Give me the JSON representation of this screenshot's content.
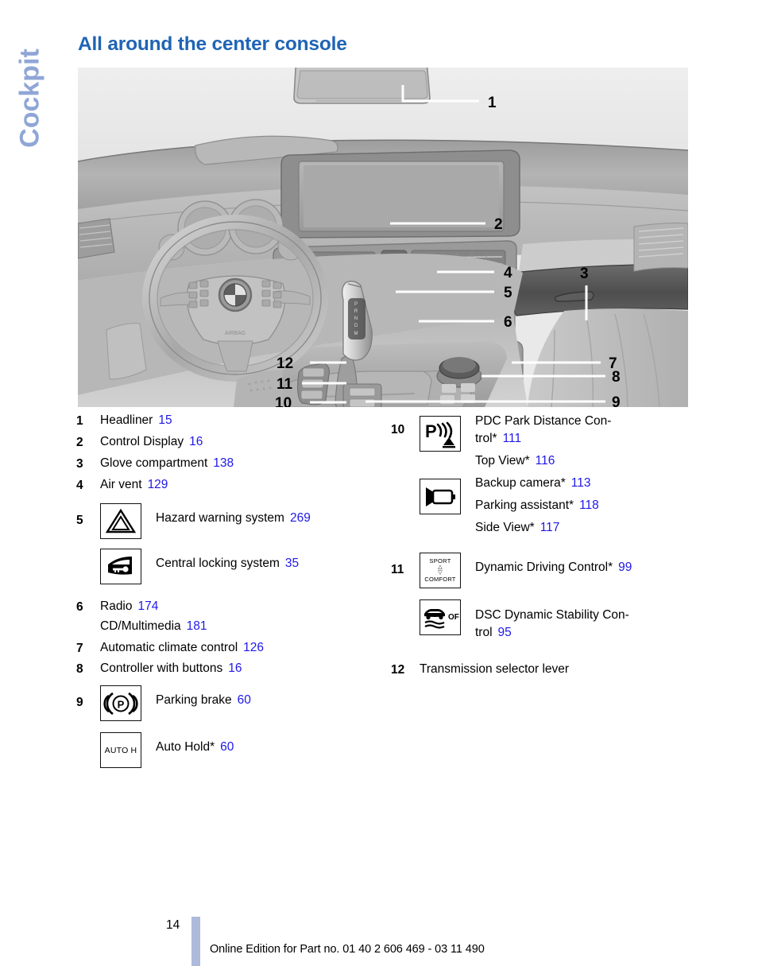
{
  "chapter_tab": "Cockpit",
  "page_title": "All around the center console",
  "illustration": {
    "alt_name": "bmw-center-console-diagram",
    "callouts": [
      "1",
      "2",
      "3",
      "4",
      "5",
      "6",
      "7",
      "8",
      "9",
      "10",
      "11",
      "12"
    ]
  },
  "legend_left": [
    {
      "num": "1",
      "label": "Headliner",
      "page": "15"
    },
    {
      "num": "2",
      "label": "Control Display",
      "page": "16"
    },
    {
      "num": "3",
      "label": "Glove compartment",
      "page": "138"
    },
    {
      "num": "4",
      "label": "Air vent",
      "page": "129"
    },
    {
      "num": "5",
      "icons": [
        {
          "icon": "hazard-warning-triangle-icon",
          "label": "Hazard warning system",
          "page": "269"
        },
        {
          "icon": "central-locking-door-key-icon",
          "label": "Central locking system",
          "page": "35"
        }
      ]
    },
    {
      "num": "6",
      "label": "Radio",
      "page": "174",
      "sub": [
        {
          "label": "CD/Multimedia",
          "page": "181"
        }
      ]
    },
    {
      "num": "7",
      "label": "Automatic climate control",
      "page": "126"
    },
    {
      "num": "8",
      "label": "Controller with buttons",
      "page": "16"
    },
    {
      "num": "9",
      "icons": [
        {
          "icon": "parking-brake-p-icon",
          "label": "Parking brake",
          "page": "60"
        },
        {
          "icon": "auto-hold-icon",
          "label": "Auto Hold*",
          "page": "60"
        }
      ]
    }
  ],
  "legend_right": [
    {
      "num": "10",
      "icon_top": "pdc-park-distance-control-icon",
      "icon_bottom": "side-view-camera-icon",
      "entries": [
        {
          "label": "PDC Park Distance Con-­trol*",
          "label_line1": "PDC Park Distance Con-",
          "label_line2": "trol*",
          "page": "111"
        },
        {
          "label": "Top View*",
          "page": "116"
        },
        {
          "label": "Backup camera*",
          "page": "113"
        },
        {
          "label": "Parking assistant*",
          "page": "118"
        },
        {
          "label": "Side View*",
          "page": "117"
        }
      ]
    },
    {
      "num": "11",
      "icons": [
        {
          "icon": "sport-comfort-dynamic-drive-icon",
          "label": "Dynamic Driving Control*",
          "page": "99"
        },
        {
          "icon": "dsc-off-icon",
          "label_line1": "DSC Dynamic Stability Con-",
          "label_line2": "trol",
          "page": "95"
        }
      ]
    },
    {
      "num": "12",
      "label": "Transmission selector lever",
      "page": ""
    }
  ],
  "icon_labels": {
    "sport": "SPORT",
    "comfort": "COMFORT",
    "auto_hold": "AUTO H",
    "dsc_off": "OFF",
    "parking_p": "P",
    "pdc_p": "P"
  },
  "footer": {
    "folio": "14",
    "note": "Online Edition for Part no. 01 40 2 606 469 - 03 11 490"
  },
  "colors": {
    "title_blue": "#1f64b5",
    "tab_blue": "#8fa6d6",
    "pageref_blue": "#1f18e8",
    "folio_bar": "#aebada"
  }
}
